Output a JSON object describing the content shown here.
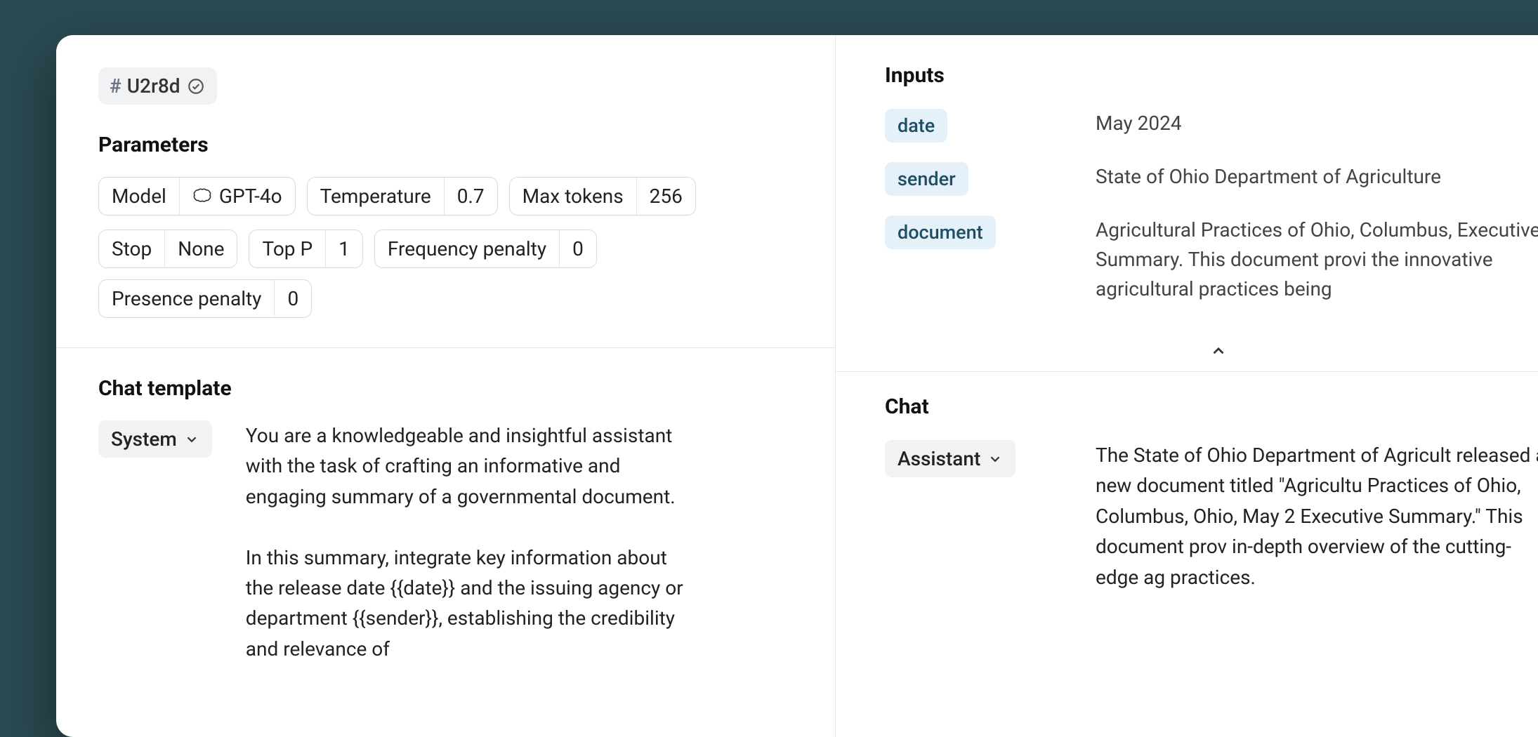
{
  "version": {
    "hash_symbol": "#",
    "id": "U2r8d"
  },
  "parameters": {
    "title": "Parameters",
    "items": [
      [
        {
          "label": "Model",
          "value": "GPT-4o",
          "icon": "openai"
        },
        {
          "label": "Temperature",
          "value": "0.7"
        },
        {
          "label": "Max tokens",
          "value": "256"
        }
      ],
      [
        {
          "label": "Stop",
          "value": "None"
        },
        {
          "label": "Top P",
          "value": "1"
        },
        {
          "label": "Frequency penalty",
          "value": "0"
        },
        {
          "label": "Presence penalty",
          "value": "0"
        }
      ]
    ]
  },
  "chat_template": {
    "title": "Chat template",
    "role": "System",
    "text": "You are a knowledgeable and insightful assistant with the task of crafting an informative and engaging summary of a governmental document.\n\nIn this summary, integrate key information about the release date {{date}} and the issuing agency or department {{sender}}, establishing the credibility and relevance of"
  },
  "inputs": {
    "title": "Inputs",
    "rows": [
      {
        "key": "date",
        "value": "May 2024"
      },
      {
        "key": "sender",
        "value": "State of Ohio Department of Agriculture"
      },
      {
        "key": "document",
        "value": "Agricultural Practices of Ohio, Columbus, Executive Summary. This document provi the innovative agricultural practices being"
      }
    ]
  },
  "chat": {
    "title": "Chat",
    "role": "Assistant",
    "text": "The State of Ohio Department of Agricult released a new document titled \"Agricultu Practices of Ohio, Columbus, Ohio, May 2 Executive Summary.\" This document prov in-depth overview of the cutting-edge ag practices."
  }
}
